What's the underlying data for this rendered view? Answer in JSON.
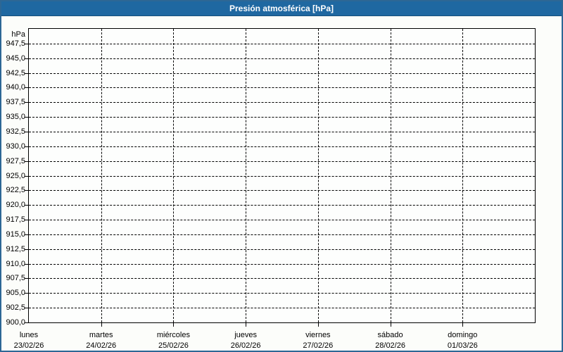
{
  "window": {
    "header_bg": "#1f68a1",
    "header_border": "#164f7c",
    "page_border": "#2d6795",
    "page_bg": "#fcfdfa",
    "grid_color": "#000000"
  },
  "chart_data": {
    "type": "line",
    "title": "Presión atmosférica [hPa]",
    "ylabel": "hPa",
    "xlabel": "",
    "ylim": [
      900,
      950
    ],
    "ytick_step": 2.5,
    "yticks": [
      900,
      902.5,
      905,
      907.5,
      910,
      912.5,
      915,
      917.5,
      920,
      922.5,
      925,
      927.5,
      930,
      932.5,
      935,
      937.5,
      940,
      942.5,
      945,
      947.5
    ],
    "ytick_labels": [
      "900,0",
      "902,5",
      "905,0",
      "907,5",
      "910,0",
      "912,5",
      "915,0",
      "917,5",
      "920,0",
      "922,5",
      "925,0",
      "927,5",
      "930,0",
      "932,5",
      "935,0",
      "937,5",
      "940,0",
      "942,5",
      "945,0",
      "947,5"
    ],
    "x_categories": [
      "lunes",
      "martes",
      "miércoles",
      "jueves",
      "viernes",
      "sábado",
      "domingo"
    ],
    "x_dates": [
      "23/02/26",
      "24/02/26",
      "25/02/26",
      "26/02/26",
      "27/02/26",
      "28/02/26",
      "01/03/26"
    ],
    "x_slots": 7,
    "series": [],
    "grid": "dashed",
    "legend": "none",
    "decimal_separator": ","
  }
}
